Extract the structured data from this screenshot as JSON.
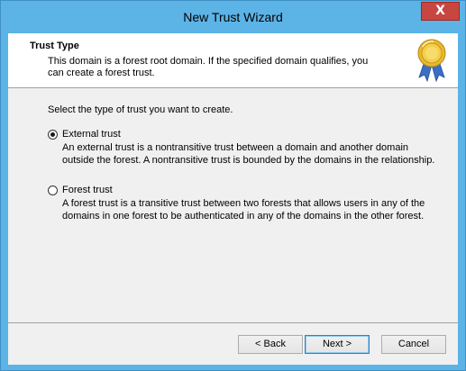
{
  "window": {
    "title": "New Trust Wizard",
    "close_label": "X"
  },
  "header": {
    "title": "Trust Type",
    "description": "This domain is a forest root domain. If the specified domain qualifies, you can create a forest trust."
  },
  "body": {
    "prompt": "Select the type of trust you want to create.",
    "options": [
      {
        "label": "External trust",
        "description": "An external trust is a nontransitive trust between a domain and another domain outside the forest. A nontransitive trust is bounded by the domains in the relationship.",
        "selected": true
      },
      {
        "label": "Forest trust",
        "description": "A forest trust is a transitive trust between two forests that allows users in any of the domains in one forest to be authenticated in any of the domains in the other forest.",
        "selected": false
      }
    ]
  },
  "footer": {
    "back_label": "< Back",
    "next_label": "Next >",
    "cancel_label": "Cancel"
  },
  "colors": {
    "frame": "#5cb3e6",
    "close_button": "#c7463f",
    "client_bg": "#f0f0f0",
    "header_bg": "#ffffff"
  },
  "icons": {
    "header_icon": "award-ribbon-icon",
    "close_icon": "close-icon"
  }
}
